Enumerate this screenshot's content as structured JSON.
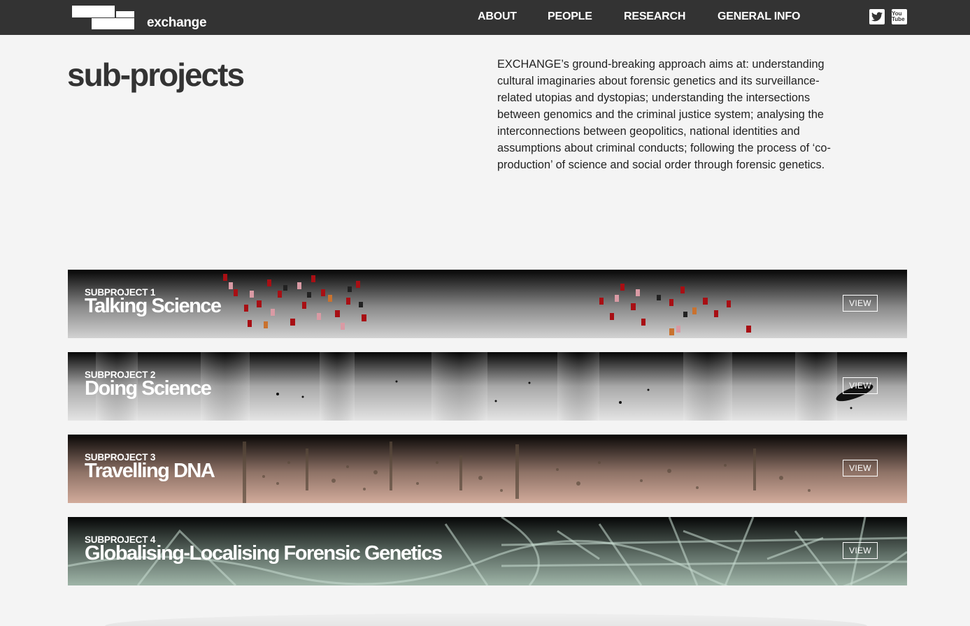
{
  "brand": {
    "name": "exchange"
  },
  "nav": {
    "items": [
      {
        "label": "ABOUT"
      },
      {
        "label": "PEOPLE"
      },
      {
        "label": "RESEARCH"
      },
      {
        "label": "GENERAL INFO"
      }
    ]
  },
  "social": {
    "icons": [
      "twitter-icon",
      "youtube-icon"
    ],
    "youtube_text": "You Tube"
  },
  "page": {
    "title": "sub-projects",
    "intro": "EXCHANGE’s ground-breaking approach aims at: understanding cultural imaginaries about forensic genetics and its surveillance-related utopias and dystopias; understanding the intersections between genomics and the criminal justice system; analysing the interconnections between geopolitics, national identities and assumptions about criminal conducts; following the process of ‘co-production’ of science and social order through forensic genetics."
  },
  "subprojects": [
    {
      "label": "SUBPROJECT 1",
      "title": "Talking Science",
      "button": "VIEW"
    },
    {
      "label": "SUBPROJECT 2",
      "title": "Doing Science",
      "button": "VIEW"
    },
    {
      "label": "SUBPROJECT 3",
      "title": "Travelling DNA",
      "button": "VIEW"
    },
    {
      "label": "SUBPROJECT 4",
      "title": "Globalising-Localising Forensic Genetics",
      "button": "VIEW"
    }
  ],
  "colors": {
    "topbar": "#333333",
    "background": "#f4f4f4",
    "text": "#333333",
    "card1": "#b8b8b8",
    "card2": "#d6d6d6",
    "card3": "#c9a797",
    "card4": "#9fb5a8"
  }
}
